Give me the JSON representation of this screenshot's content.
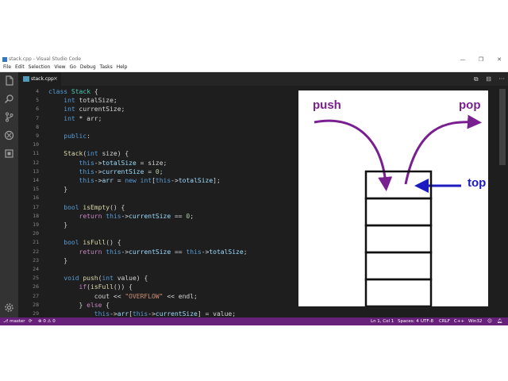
{
  "window": {
    "title": "stack.cpp - Visual Studio Code",
    "controls": {
      "minimize": "—",
      "restore": "❐",
      "close": "✕"
    }
  },
  "menu": [
    "File",
    "Edit",
    "Selection",
    "View",
    "Go",
    "Debug",
    "Tasks",
    "Help"
  ],
  "activity_bar": {
    "icons": [
      "files-icon",
      "search-icon",
      "source-control-icon",
      "debug-icon",
      "extensions-icon",
      "settings-gear-icon"
    ]
  },
  "tab": {
    "label": "stack.cpp",
    "close": "×"
  },
  "editor_actions": [
    "⧉",
    "⊟",
    "···"
  ],
  "line_numbers": [
    "4",
    "5",
    "6",
    "7",
    "8",
    "9",
    "10",
    "11",
    "12",
    "13",
    "14",
    "15",
    "16",
    "17",
    "18",
    "19",
    "20",
    "21",
    "22",
    "23",
    "24",
    "25",
    "26",
    "27",
    "28",
    "29"
  ],
  "code_lines": [
    [
      [
        "kw",
        "class"
      ],
      [
        "p",
        " "
      ],
      [
        "ty",
        "Stack"
      ],
      [
        "p",
        " {"
      ]
    ],
    [
      [
        "p",
        "    "
      ],
      [
        "kw",
        "int"
      ],
      [
        "p",
        " totalSize;"
      ]
    ],
    [
      [
        "p",
        "    "
      ],
      [
        "kw",
        "int"
      ],
      [
        "p",
        " currentSize;"
      ]
    ],
    [
      [
        "p",
        "    "
      ],
      [
        "kw",
        "int"
      ],
      [
        "p",
        " * arr;"
      ]
    ],
    [],
    [
      [
        "p",
        "    "
      ],
      [
        "kw",
        "public"
      ],
      [
        "p",
        ":"
      ]
    ],
    [],
    [
      [
        "p",
        "    "
      ],
      [
        "fn",
        "Stack"
      ],
      [
        "p",
        "("
      ],
      [
        "kw",
        "int"
      ],
      [
        "p",
        " size) {"
      ]
    ],
    [
      [
        "p",
        "        "
      ],
      [
        "kw",
        "this"
      ],
      [
        "p",
        "->"
      ],
      [
        "var",
        "totalSize"
      ],
      [
        "p",
        " = size;"
      ]
    ],
    [
      [
        "p",
        "        "
      ],
      [
        "kw",
        "this"
      ],
      [
        "p",
        "->"
      ],
      [
        "var",
        "currentSize"
      ],
      [
        "p",
        " = "
      ],
      [
        "nm",
        "0"
      ],
      [
        "p",
        ";"
      ]
    ],
    [
      [
        "p",
        "        "
      ],
      [
        "kw",
        "this"
      ],
      [
        "p",
        "->"
      ],
      [
        "var",
        "arr"
      ],
      [
        "p",
        " = "
      ],
      [
        "kw",
        "new"
      ],
      [
        "p",
        " "
      ],
      [
        "kw",
        "int"
      ],
      [
        "p",
        "["
      ],
      [
        "kw",
        "this"
      ],
      [
        "p",
        "->"
      ],
      [
        "var",
        "totalSize"
      ],
      [
        "p",
        "];"
      ]
    ],
    [
      [
        "p",
        "    }"
      ]
    ],
    [],
    [
      [
        "p",
        "    "
      ],
      [
        "kw",
        "bool"
      ],
      [
        "p",
        " "
      ],
      [
        "fn",
        "isEmpty"
      ],
      [
        "p",
        "() {"
      ]
    ],
    [
      [
        "p",
        "        "
      ],
      [
        "ctl",
        "return"
      ],
      [
        "p",
        " "
      ],
      [
        "kw",
        "this"
      ],
      [
        "p",
        "->"
      ],
      [
        "var",
        "currentSize"
      ],
      [
        "p",
        " == "
      ],
      [
        "nm",
        "0"
      ],
      [
        "p",
        ";"
      ]
    ],
    [
      [
        "p",
        "    }"
      ]
    ],
    [],
    [
      [
        "p",
        "    "
      ],
      [
        "kw",
        "bool"
      ],
      [
        "p",
        " "
      ],
      [
        "fn",
        "isFull"
      ],
      [
        "p",
        "() {"
      ]
    ],
    [
      [
        "p",
        "        "
      ],
      [
        "ctl",
        "return"
      ],
      [
        "p",
        " "
      ],
      [
        "kw",
        "this"
      ],
      [
        "p",
        "->"
      ],
      [
        "var",
        "currentSize"
      ],
      [
        "p",
        " == "
      ],
      [
        "kw",
        "this"
      ],
      [
        "p",
        "->"
      ],
      [
        "var",
        "totalSize"
      ],
      [
        "p",
        ";"
      ]
    ],
    [
      [
        "p",
        "    }"
      ]
    ],
    [],
    [
      [
        "p",
        "    "
      ],
      [
        "kw",
        "void"
      ],
      [
        "p",
        " "
      ],
      [
        "fn",
        "push"
      ],
      [
        "p",
        "("
      ],
      [
        "kw",
        "int"
      ],
      [
        "p",
        " value) {"
      ]
    ],
    [
      [
        "p",
        "        "
      ],
      [
        "ctl",
        "if"
      ],
      [
        "p",
        "("
      ],
      [
        "fn",
        "isFull"
      ],
      [
        "p",
        "()) {"
      ]
    ],
    [
      [
        "p",
        "            cout << "
      ],
      [
        "st",
        "\"OVERFLOW\""
      ],
      [
        "p",
        " << endl;"
      ]
    ],
    [
      [
        "p",
        "        } "
      ],
      [
        "ctl",
        "else"
      ],
      [
        "p",
        " {"
      ]
    ],
    [
      [
        "p",
        "            "
      ],
      [
        "kw",
        "this"
      ],
      [
        "p",
        "->"
      ],
      [
        "var",
        "arr"
      ],
      [
        "p",
        "["
      ],
      [
        "kw",
        "this"
      ],
      [
        "p",
        "->"
      ],
      [
        "var",
        "currentSize"
      ],
      [
        "p",
        "] = value;"
      ]
    ]
  ],
  "status_bar": {
    "branch": "master",
    "sync_icon": "sync-icon",
    "errors": "0",
    "warnings": "0",
    "position": "Ln 1, Col 1",
    "spaces": "Spaces: 4",
    "encoding": "UTF-8",
    "eol": "CRLF",
    "language": "C++",
    "platform": "Win32"
  },
  "diagram": {
    "push_label": "push",
    "pop_label": "pop",
    "top_label": "top",
    "stack_slots": 5,
    "arrow_color": "#7a1f8f",
    "top_arrow_color": "#1b1bbf"
  },
  "colors": {
    "status_bar": "#68217a",
    "editor_bg": "#1e1e1e"
  }
}
